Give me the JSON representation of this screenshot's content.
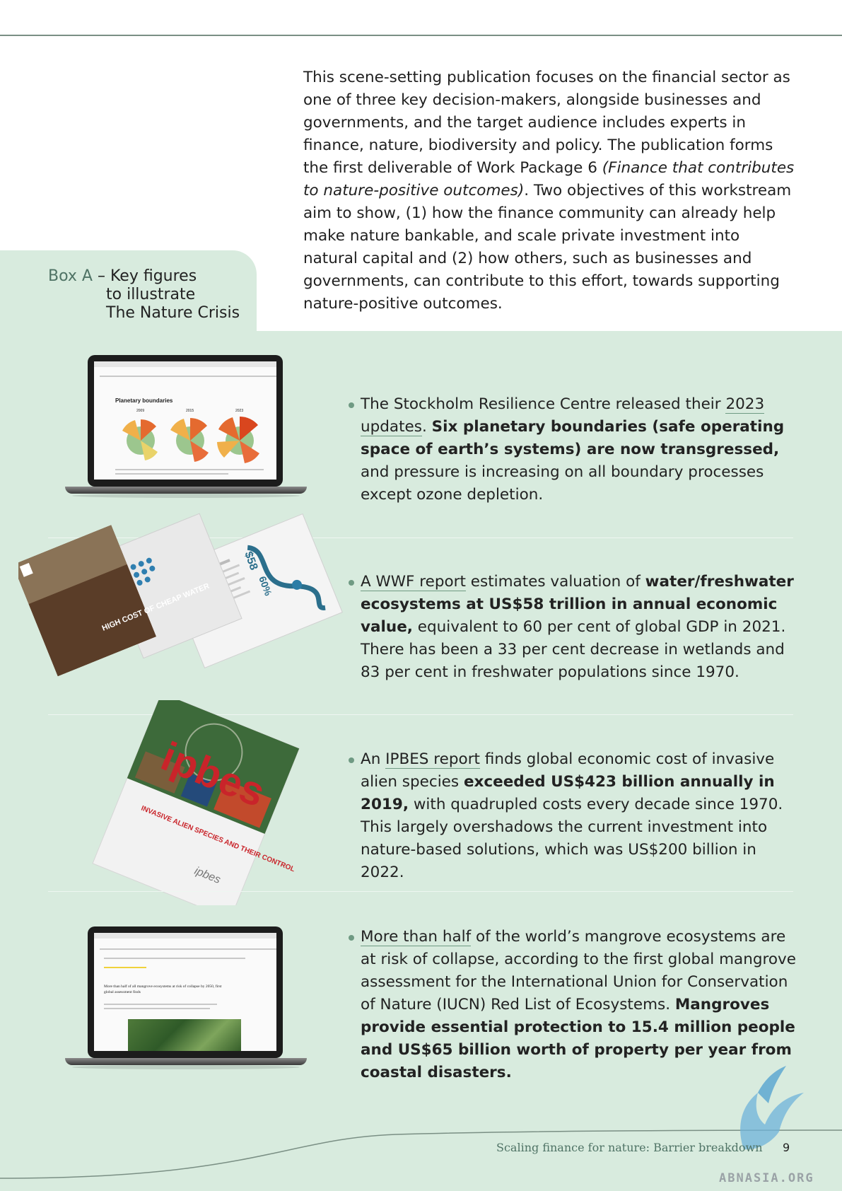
{
  "intro": {
    "text_before": "This scene-setting publication focuses on the financial sector as one of three key decision-makers, alongside businesses and governments, and the target audience includes experts in finance, nature, biodiversity and policy. The publication forms the first deliverable of Work Package 6 ",
    "italic": "(Finance that contributes to nature-positive outcomes)",
    "text_after": ". Two objectives of this workstream aim to show, (1) how the finance community can already help make nature bankable, and scale private investment into natural capital and (2) how others, such as businesses and governments, can contribute to this effort, towards supporting nature-positive outcomes."
  },
  "box": {
    "label": "Box A",
    "separator": " – ",
    "line1": "Key figures",
    "line2": "to illustrate",
    "line3": "The Nature Crisis"
  },
  "items": [
    {
      "pre": "The Stockholm Resilience Centre released their ",
      "link": "2023 updates",
      "mid": ". ",
      "bold": "Six planetary boundaries (safe operating space of earth’s systems) are now transgressed,",
      "post": " and pressure is increasing on all boundary processes except ozone depletion."
    },
    {
      "pre": "",
      "link": "A WWF report",
      "mid": " estimates valuation of ",
      "bold": "water/freshwater ecosystems at US$58 trillion in annual economic value,",
      "post": " equivalent to 60 per cent of global GDP in 2021. There has been a 33 per cent decrease in wetlands and 83 per cent in freshwater populations since 1970."
    },
    {
      "pre": "An ",
      "link": "IPBES report",
      "mid": " finds global economic cost of invasive alien species ",
      "bold": "exceeded US$423 billion annually in 2019,",
      "post": " with quadrupled costs every decade since 1970. This largely overshadows the current investment into nature-based solutions, which was US$200 billion in 2022."
    },
    {
      "pre": "",
      "link": "More than half",
      "mid": " of the world’s mangrove ecosystems are at risk of collapse, according to the first global mangrove assessment for the International Union for Conservation of Nature (IUCN) Red List of Ecosystems. ",
      "bold": "Mangroves provide essential protection to 15.4 million people and US$65 billion worth of property per year from coastal disasters.",
      "post": ""
    }
  ],
  "graphics": {
    "laptop1_title": "Planetary boundaries",
    "laptop1_years": [
      "2009",
      "2015",
      "2023"
    ],
    "brochure1_cover": "HIGH COST OF CHEAP WATER",
    "brochure1_stat1": "$58",
    "brochure1_stat2": "60%",
    "brochure2_brand": "ipbes",
    "brochure2_title": "INVASIVE ALIEN SPECIES AND THEIR CONTROL",
    "laptop2_headline": "More than half of all mangrove ecosystems at risk of collapse by 2050, first global assessment finds"
  },
  "footer": {
    "label": "Scaling finance for nature: Barrier breakdown",
    "page": "9",
    "watermark": "ABNASIA.ORG"
  },
  "colors": {
    "panel": "#d8ebde",
    "accent": "#6f9a83",
    "label": "#4f7365"
  }
}
